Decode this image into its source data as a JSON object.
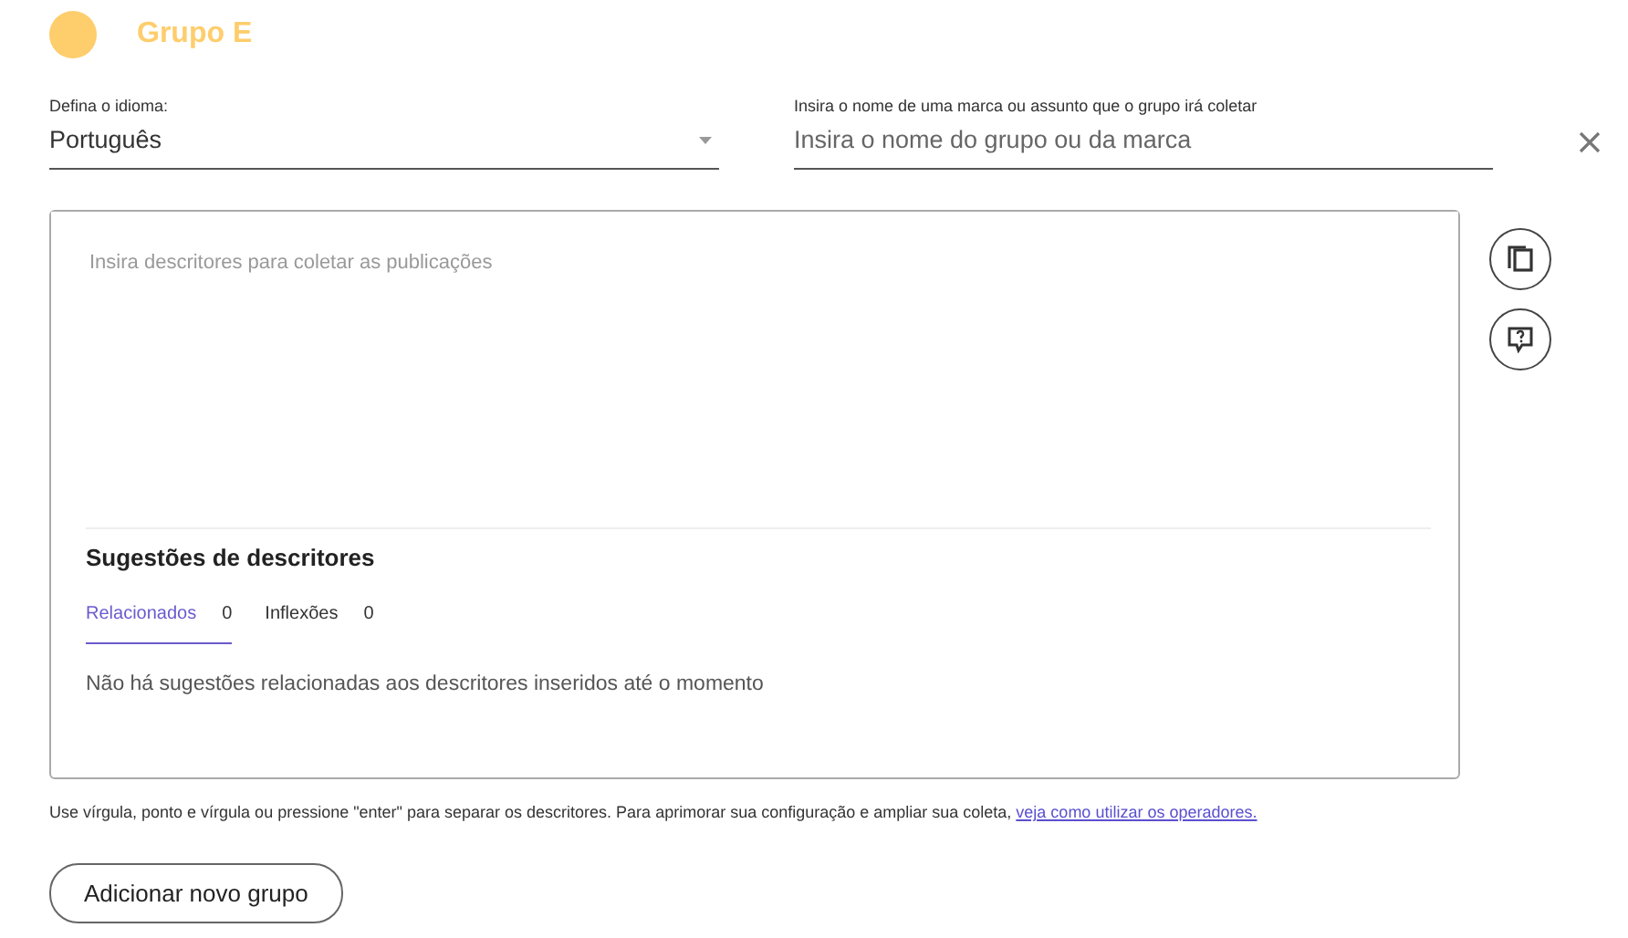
{
  "group": {
    "title": "Grupo E"
  },
  "language": {
    "label": "Defina o idioma:",
    "value": "Português"
  },
  "name_field": {
    "label": "Insira o nome de uma marca ou assunto que o grupo irá coletar",
    "placeholder": "Insira o nome do grupo ou da marca"
  },
  "descriptors": {
    "placeholder": "Insira descritores para coletar as publicações"
  },
  "suggestions": {
    "title": "Sugestões de descritores",
    "tabs": [
      {
        "label": "Relacionados",
        "count": "0",
        "selected": true
      },
      {
        "label": "Inflexões",
        "count": "0",
        "selected": false
      }
    ],
    "empty_message": "Não há sugestões relacionadas aos descritores inseridos até o momento"
  },
  "hint": {
    "text": "Use vírgula, ponto e vírgula ou pressione \"enter\" para separar os descritores. Para aprimorar sua configuração e ampliar sua coleta,",
    "link": "veja como utilizar os operadores."
  },
  "buttons": [
    "Adicionar novo grupo"
  ]
}
